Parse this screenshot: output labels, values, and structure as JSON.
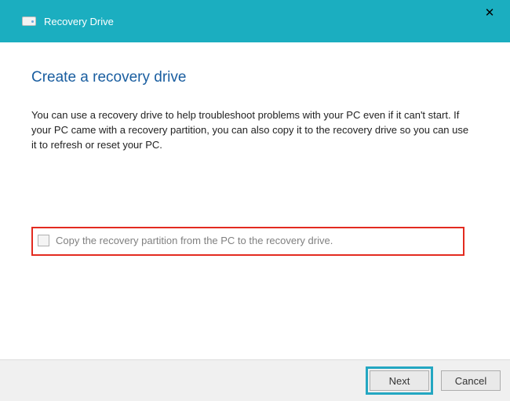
{
  "titlebar": {
    "app_title": "Recovery Drive"
  },
  "page": {
    "heading": "Create a recovery drive",
    "body": "You can use a recovery drive to help troubleshoot problems with your PC even if it can't start. If your PC came with a recovery partition, you can also copy it to the recovery drive so you can use it to refresh or reset your PC."
  },
  "option": {
    "copy_partition_label": "Copy the recovery partition from the PC to the recovery drive.",
    "checked": false
  },
  "footer": {
    "next_label": "Next",
    "cancel_label": "Cancel"
  }
}
